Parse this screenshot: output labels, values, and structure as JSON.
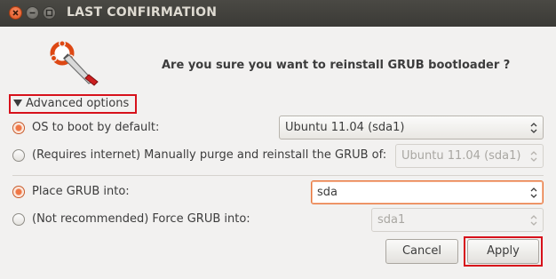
{
  "window": {
    "title": "LAST CONFIRMATION"
  },
  "question": "Are you sure you want to reinstall GRUB bootloader ?",
  "advanced": {
    "label": "Advanced options"
  },
  "options": {
    "os_default": {
      "label": "OS to boot by default:",
      "value": "Ubuntu 11.04 (sda1)",
      "selected": true
    },
    "purge": {
      "label": "(Requires internet) Manually purge and reinstall the GRUB of:",
      "value": "Ubuntu 11.04 (sda1)",
      "selected": false
    },
    "place_grub": {
      "label": "Place GRUB into:",
      "value": "sda",
      "selected": true
    },
    "force_grub": {
      "label": "(Not recommended) Force GRUB into:",
      "value": "sda1",
      "selected": false
    }
  },
  "buttons": {
    "cancel": "Cancel",
    "apply": "Apply"
  },
  "colors": {
    "accent": "#f07746",
    "highlight_frame": "#d7111b",
    "titlebar": "#3c3b37"
  },
  "icons": {
    "logo": "boot-repair-wrench-icon"
  }
}
